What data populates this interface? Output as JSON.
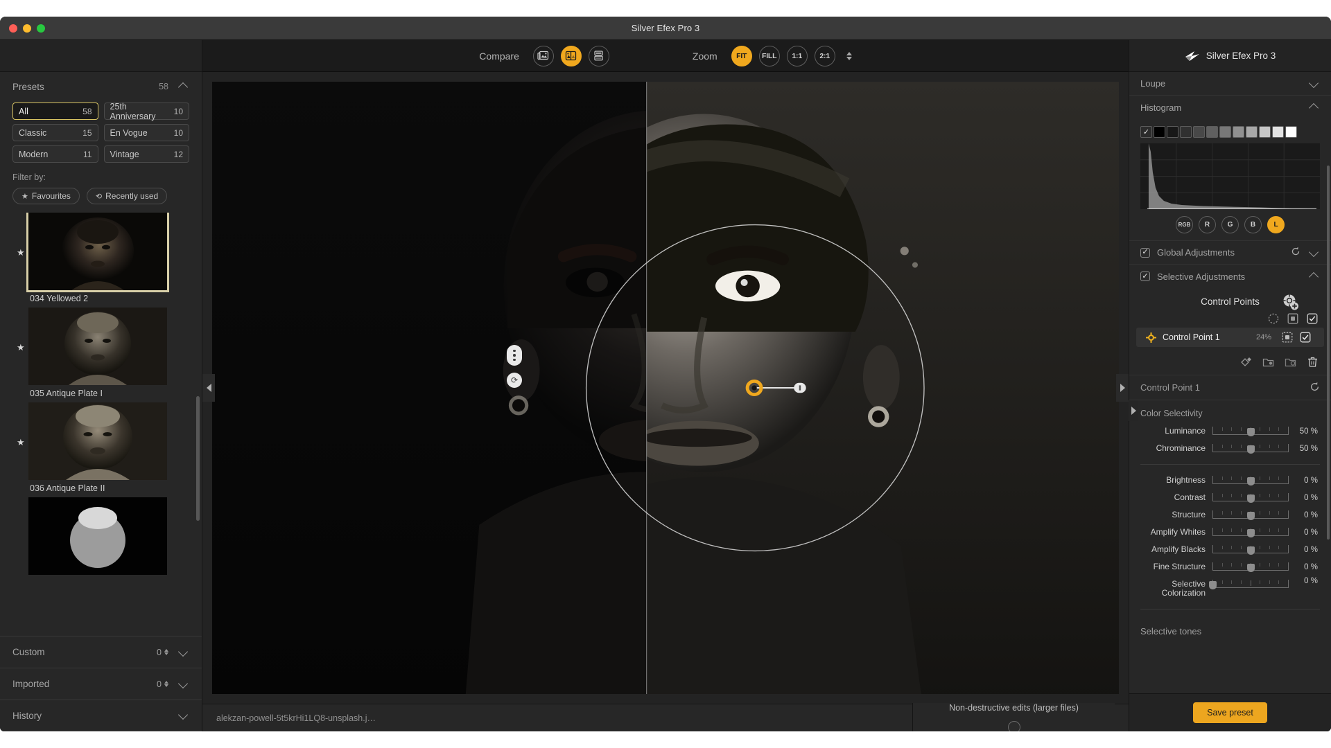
{
  "window": {
    "title": "Silver Efex Pro 3",
    "controls": [
      "close",
      "minimize",
      "maximize"
    ]
  },
  "left_panel": {
    "presets": {
      "label": "Presets",
      "count": "58",
      "collapse_icon": "chevron-up-icon",
      "categories": [
        {
          "label": "All",
          "count": "58",
          "selected": true
        },
        {
          "label": "25th Anniversary",
          "count": "10",
          "selected": false
        },
        {
          "label": "Classic",
          "count": "15",
          "selected": false
        },
        {
          "label": "En Vogue",
          "count": "10",
          "selected": false
        },
        {
          "label": "Modern",
          "count": "11",
          "selected": false
        },
        {
          "label": "Vintage",
          "count": "12",
          "selected": false
        }
      ],
      "filter_label": "Filter by:",
      "filter_pills": [
        {
          "label": "Favourites",
          "icon": "star-icon"
        },
        {
          "label": "Recently used",
          "icon": "history-icon"
        }
      ],
      "items": [
        {
          "name": "034 Yellowed 2",
          "favourite": true,
          "selected": true
        },
        {
          "name": "035 Antique Plate I",
          "favourite": true,
          "selected": false
        },
        {
          "name": "036 Antique Plate II",
          "favourite": true,
          "selected": false
        },
        {
          "name": "",
          "favourite": false,
          "selected": false
        }
      ]
    },
    "sections": [
      {
        "label": "Custom",
        "count": "0",
        "has_spinner": true
      },
      {
        "label": "Imported",
        "count": "0",
        "has_spinner": true
      },
      {
        "label": "History",
        "count": "",
        "has_spinner": false
      }
    ]
  },
  "toolbar": {
    "compare_label": "Compare",
    "compare_buttons": [
      {
        "name": "single-view",
        "active": false
      },
      {
        "name": "split-view",
        "active": true
      },
      {
        "name": "side-by-side-view",
        "active": false
      }
    ],
    "zoom_label": "Zoom",
    "zoom_buttons": [
      {
        "label": "FIT",
        "active": true
      },
      {
        "label": "FILL",
        "active": false
      },
      {
        "label": "1:1",
        "active": false
      },
      {
        "label": "2:1",
        "active": false
      }
    ]
  },
  "status_bar": {
    "filename": "alekzan-powell-5t5krHi1LQ8-unsplash.j…",
    "nondestructive_label": "Non-destructive edits (larger files)",
    "toggle_on": false
  },
  "right_panel": {
    "brand": "Silver Efex Pro 3",
    "loupe": {
      "label": "Loupe",
      "expanded": false
    },
    "histogram": {
      "label": "Histogram",
      "expanded": true,
      "zone_checkbox_checked": true,
      "zones": 11,
      "channels": [
        {
          "label": "RGB",
          "active": false
        },
        {
          "label": "R",
          "active": false
        },
        {
          "label": "G",
          "active": false
        },
        {
          "label": "B",
          "active": false
        },
        {
          "label": "L",
          "active": true
        }
      ]
    },
    "global_adjustments": {
      "label": "Global Adjustments",
      "checked": true,
      "expanded": false
    },
    "selective_adjustments": {
      "label": "Selective Adjustments",
      "checked": true,
      "expanded": true
    },
    "control_points": {
      "title": "Control Points",
      "add_icon": "add-control-point-icon",
      "rows": [
        {
          "name": "Control Point 1",
          "opacity": "24%",
          "mask_visible": true,
          "enabled": true,
          "selected": true
        }
      ],
      "tools": [
        "duplicate-icon",
        "group-icon",
        "ungroup-icon",
        "delete-icon"
      ]
    },
    "control_point_detail": {
      "title": "Control Point 1",
      "reset_icon": "reset-icon",
      "color_selectivity_label": "Color Selectivity",
      "color_selectivity": [
        {
          "label": "Luminance",
          "value": "50 %",
          "pos": 50
        },
        {
          "label": "Chrominance",
          "value": "50 %",
          "pos": 50
        }
      ],
      "adjustments": [
        {
          "label": "Brightness",
          "value": "0 %",
          "pos": 50
        },
        {
          "label": "Contrast",
          "value": "0 %",
          "pos": 50
        },
        {
          "label": "Structure",
          "value": "0 %",
          "pos": 50
        },
        {
          "label": "Amplify Whites",
          "value": "0 %",
          "pos": 50
        },
        {
          "label": "Amplify Blacks",
          "value": "0 %",
          "pos": 50
        },
        {
          "label": "Fine Structure",
          "value": "0 %",
          "pos": 50
        },
        {
          "label": "Selective Colorization",
          "value": "0 %",
          "pos": 0
        }
      ]
    },
    "selective_tones": {
      "label": "Selective tones"
    },
    "footer": {
      "save_label": "Save preset"
    }
  },
  "colors": {
    "accent": "#f0a81e",
    "panel": "#272727",
    "selected_border": "#d8c463"
  }
}
